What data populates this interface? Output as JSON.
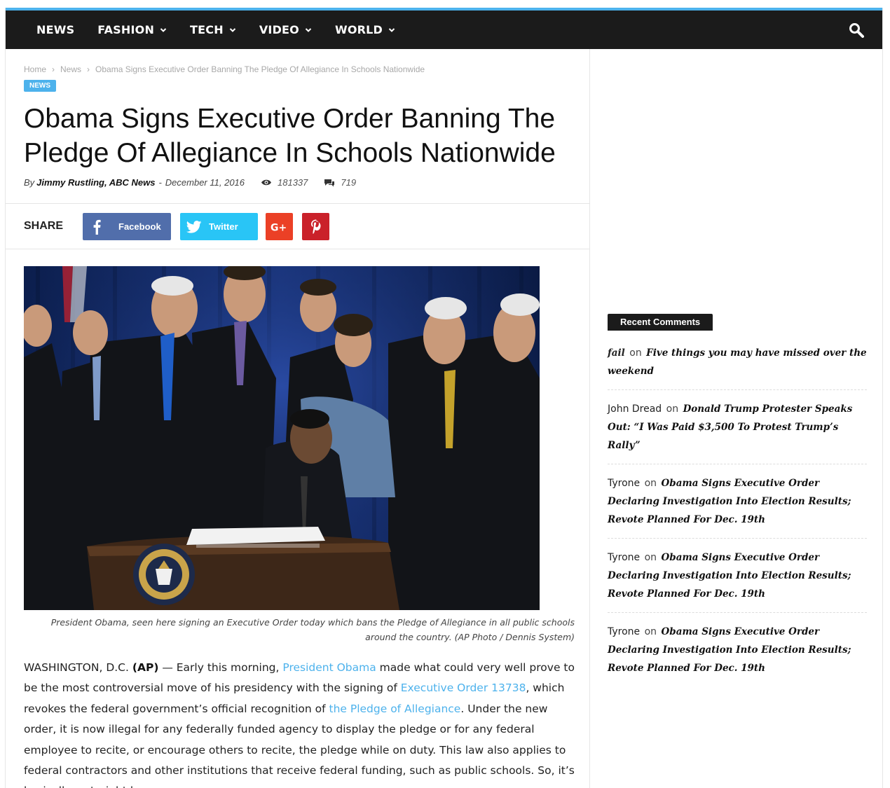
{
  "colors": {
    "accent": "#4db2ec",
    "nav_bg": "#1b1b1b",
    "facebook": "#516eab",
    "twitter": "#29c5f6",
    "google_plus": "#eb4026",
    "pinterest": "#ca212a"
  },
  "nav": {
    "items": [
      {
        "label": "NEWS",
        "has_dropdown": false
      },
      {
        "label": "FASHION",
        "has_dropdown": true
      },
      {
        "label": "TECH",
        "has_dropdown": true
      },
      {
        "label": "VIDEO",
        "has_dropdown": true
      },
      {
        "label": "WORLD",
        "has_dropdown": true
      }
    ],
    "search_icon": "search-icon"
  },
  "breadcrumb": {
    "home": "Home",
    "section": "News",
    "current": "Obama Signs Executive Order Banning The Pledge Of Allegiance In Schools Nationwide"
  },
  "article": {
    "category": "NEWS",
    "title": "Obama Signs Executive Order Banning The Pledge Of Allegiance In Schools Nationwide",
    "by_label": "By",
    "author": "Jimmy Rustling, ABC News",
    "separator": "-",
    "date": "December 11, 2016",
    "views": "181337",
    "comments": "719",
    "caption": "President Obama, seen here signing an Executive Order today which bans the Pledge of Allegiance in all public schools around the country. (AP Photo / Dennis System)",
    "body": {
      "dateline": "WASHINGTON, D.C.",
      "agency": "(AP)",
      "t1": " — Early this morning, ",
      "link1": "President Obama",
      "t2": " made what could very well prove to be the most controversial move of his presidency with the signing of ",
      "link2": "Executive Order 13738",
      "t3": ", which revokes the federal government’s official recognition of ",
      "link3": "the Pledge of Allegiance",
      "t4": ". Under the new order, it is now illegal for any federally funded agency to display the pledge or for any federal employee to recite, or encourage others to recite, the pledge while on duty. This law also applies to federal contractors and other institutions that receive federal funding, such as public schools. So, it’s basically a straight ban."
    }
  },
  "share": {
    "label": "SHARE",
    "facebook": "Facebook",
    "twitter": "Twitter"
  },
  "sidebar": {
    "recent_comments_title": "Recent Comments",
    "on_word": "on",
    "comments": [
      {
        "author": "fail",
        "author_style": "italic",
        "post": "Five things you may have missed over the weekend"
      },
      {
        "author": "John Dread",
        "author_style": "normal",
        "post": "Donald Trump Protester Speaks Out: “I Was Paid $3,500 To Protest Trump’s Rally”"
      },
      {
        "author": "Tyrone",
        "author_style": "normal",
        "post": "Obama Signs Executive Order Declaring Investigation Into Election Results; Revote Planned For Dec. 19th"
      },
      {
        "author": "Tyrone",
        "author_style": "normal",
        "post": "Obama Signs Executive Order Declaring Investigation Into Election Results; Revote Planned For Dec. 19th"
      },
      {
        "author": "Tyrone",
        "author_style": "normal",
        "post": "Obama Signs Executive Order Declaring Investigation Into Election Results; Revote Planned For Dec. 19th"
      }
    ]
  }
}
